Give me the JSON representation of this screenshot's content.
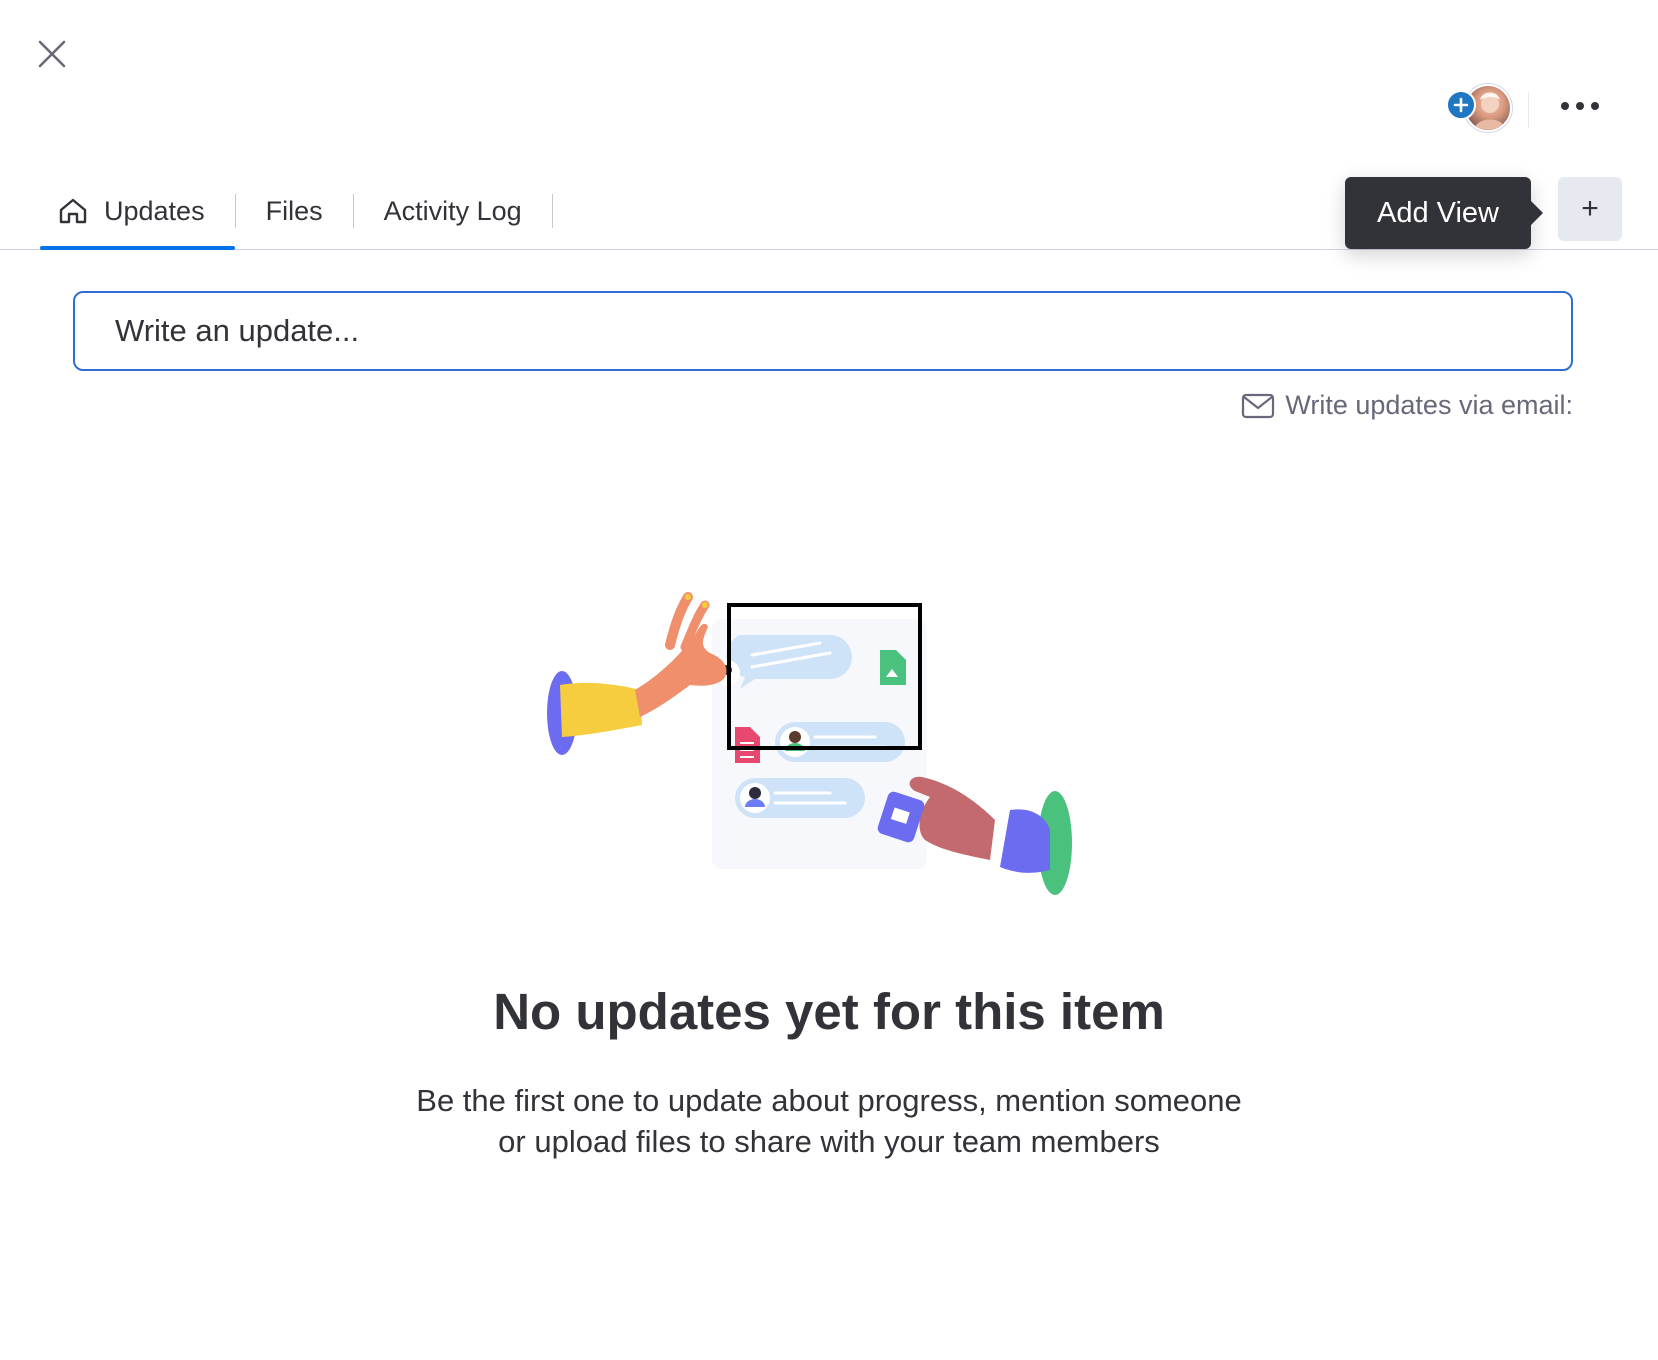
{
  "header": {
    "close_icon": "close-icon",
    "more_icon": "more-horizontal-icon"
  },
  "tabs": [
    {
      "label": "Updates",
      "icon": "home-icon",
      "active": true
    },
    {
      "label": "Files",
      "active": false
    },
    {
      "label": "Activity Log",
      "active": false
    }
  ],
  "add_view": {
    "tooltip": "Add View",
    "button_label": "+"
  },
  "update_input": {
    "placeholder": "Write an update..."
  },
  "email_link": {
    "label": "Write updates via email:",
    "icon": "mail-icon"
  },
  "empty_state": {
    "title": "No updates yet for this item",
    "subtitle_line1": "Be the first one to update about progress, mention someone",
    "subtitle_line2": "or upload files to share with your team members"
  },
  "colors": {
    "accent": "#0073ea",
    "input_border": "#2f6fd3",
    "tooltip_bg": "#323338",
    "text": "#323338",
    "muted": "#676879"
  }
}
